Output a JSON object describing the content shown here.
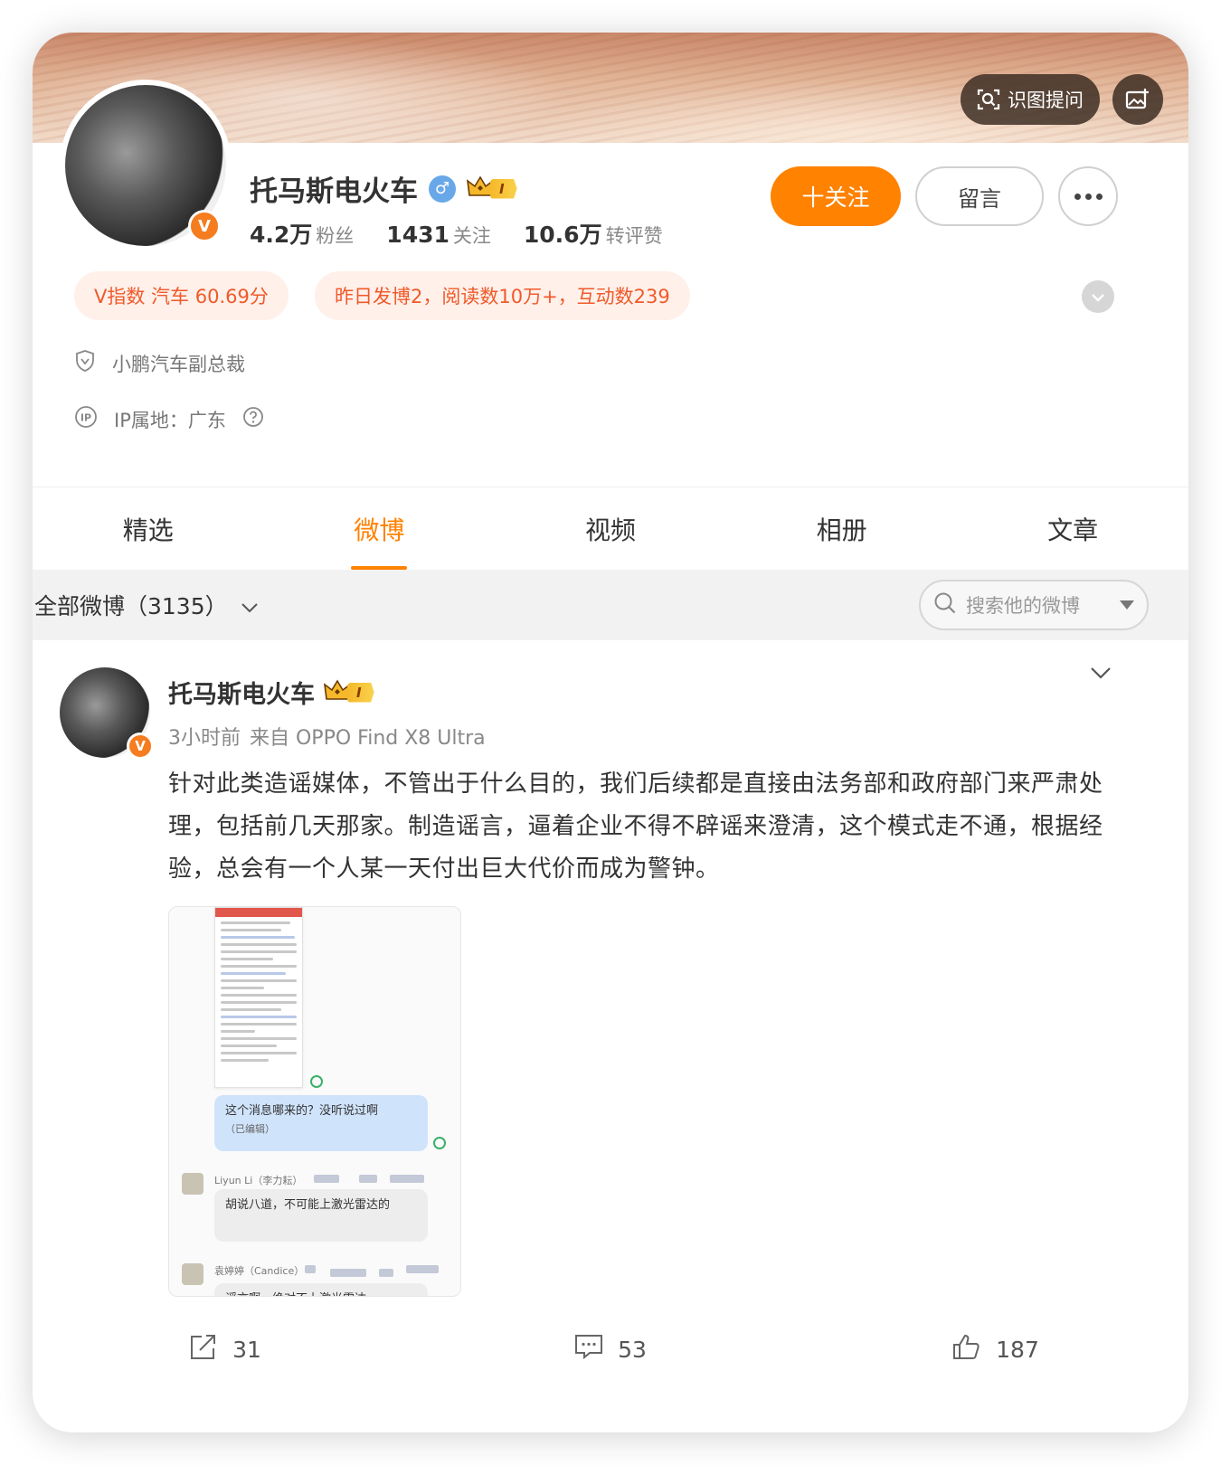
{
  "cover": {
    "ask_button": "识图提问",
    "ask_icon": "scan-icon",
    "image_icon": "image-edit-icon"
  },
  "profile": {
    "name": "托马斯电火车",
    "gender_symbol": "♂",
    "verified_badge": "V",
    "level_badge": "I",
    "stats": [
      {
        "value": "4.2万",
        "label": "粉丝"
      },
      {
        "value": "1431",
        "label": "关注"
      },
      {
        "value": "10.6万",
        "label": "转评赞"
      }
    ],
    "follow_button": "十关注",
    "message_button": "留言",
    "v_index": "V指数 汽车 60.69分",
    "post_summary": "昨日发博2，阅读数10万+，互动数239",
    "title": "小鹏汽车副总裁",
    "ip_location": "IP属地：广东"
  },
  "tabs": [
    {
      "label": "精选",
      "active": false
    },
    {
      "label": "微博",
      "active": true
    },
    {
      "label": "视频",
      "active": false
    },
    {
      "label": "相册",
      "active": false
    },
    {
      "label": "文章",
      "active": false
    }
  ],
  "filter": {
    "label": "全部微博（3135）",
    "search_placeholder": "搜索他的微博"
  },
  "post": {
    "author": "托马斯电火车",
    "level_badge": "I",
    "time": "3小时前",
    "source": "来自 OPPO Find X8 Ultra",
    "text": "针对此类造谣媒体，不管出于什么目的，我们后续都是直接由法务部和政府部门来严肃处理，包括前几天那家。制造谣言，逼着企业不得不辟谣来澄清，这个模式走不通，根据经验，总会有一个人某一天付出巨大代价而成为警钟。",
    "image": {
      "bubble1": "这个消息哪来的？没听说过啊",
      "bubble1_note": "（已编辑）",
      "sender2": "Liyun Li（李力耘）",
      "bubble2": "胡说八道，不可能上激光雷达的",
      "sender3": "袁婷婷（Candice）",
      "bubble3": "谣言啊，绝对不上激光雷达"
    },
    "actions": {
      "reposts": "31",
      "comments": "53",
      "likes": "187"
    }
  },
  "colors": {
    "accent": "#ff8200",
    "pill_bg": "#fff0ea",
    "pill_text": "#f05a2a",
    "verified": "#f57c1f"
  }
}
